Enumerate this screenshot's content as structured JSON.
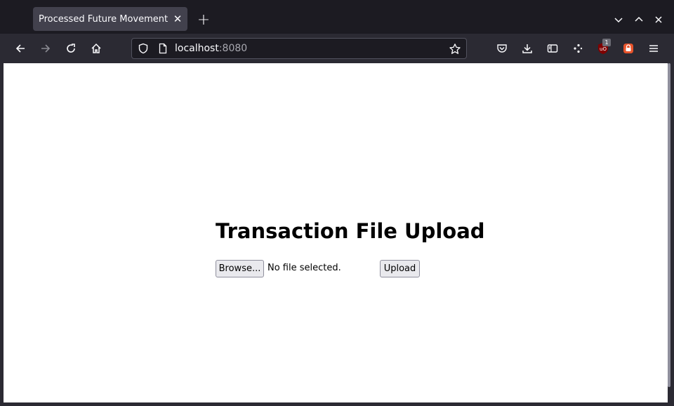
{
  "browser": {
    "tab": {
      "title": "Processed Future Movement",
      "close_glyph": "✕"
    },
    "new_tab_glyph": "+",
    "url": {
      "host": "localhost",
      "port": ":8080"
    },
    "extension_badge": "1",
    "icons": [
      "back-arrow-icon",
      "forward-arrow-icon",
      "reload-icon",
      "home-icon",
      "shield-icon",
      "page-icon",
      "star-icon",
      "pocket-icon",
      "download-icon",
      "sidebar-icon",
      "extension-icon",
      "ublock-icon",
      "addon-icon",
      "menu-icon",
      "chevron-down-icon",
      "chevron-up-icon",
      "close-icon"
    ],
    "colors": {
      "chrome": "#2b2a33",
      "tabstrip": "#1c1b22",
      "active_tab": "#42414d",
      "ublock": "#800000",
      "addon": "#e8542c"
    }
  },
  "page": {
    "heading": "Transaction File Upload",
    "browse_label": "Browse...",
    "file_status": "No file selected.",
    "upload_label": "Upload"
  }
}
